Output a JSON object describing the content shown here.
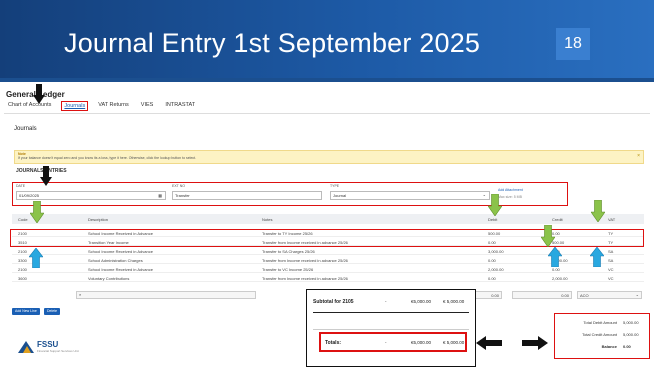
{
  "slide": {
    "title": "Journal Entry 1st September 2025",
    "number": "18",
    "colors": {
      "banner": "#1d5aa6",
      "highlight": "#d11111",
      "green_arrow": "#8bc34a",
      "blue_arrow": "#29a8e0"
    }
  },
  "app": {
    "title": "General Ledger",
    "nav": [
      "Chart of Accounts",
      "Journals",
      "VAT Returns",
      "VIES",
      "INTRASTAT"
    ],
    "section_title": "Journals",
    "warning": {
      "heading": "Note",
      "text": "If your balance doesn't equal zero and you know its a loss, type it here. Otherwise, click the lookup button to select.",
      "close": "×"
    },
    "journal_title": "JOURNALS ENTRIES",
    "form": {
      "date_label": "DATE",
      "date_value": "01/09/2025",
      "ref_label": "EXT NO",
      "ref_value": "Transfer",
      "type_label": "TYPE",
      "type_value": "Journal",
      "attach_link": "Add Attachment",
      "attach_sub": "Max size: 5 MB"
    },
    "table": {
      "headers": [
        "Code",
        "Description",
        "Notes",
        "Debit",
        "Credit",
        "VAT"
      ],
      "rows": [
        {
          "code": "2100",
          "desc": "School Income Received in Advance",
          "notes": "Transfer to TY Income 25/26",
          "debit": "500.00",
          "credit": "0.00",
          "vat": "TY"
        },
        {
          "code": "3510",
          "desc": "Transition Year Income",
          "notes": "Transfer from Income received in advance 25/26",
          "debit": "0.00",
          "credit": "500.00",
          "vat": "TY"
        },
        {
          "code": "2100",
          "desc": "School Income Received in Advance",
          "notes": "Transfer to SA Charges 25/26",
          "debit": "3,000.00",
          "credit": "0.00",
          "vat": "SA"
        },
        {
          "code": "3300",
          "desc": "School Administration Charges",
          "notes": "Transfer from Income received in advance 25/26",
          "debit": "0.00",
          "credit": "3,000.00",
          "vat": "SA"
        },
        {
          "code": "2100",
          "desc": "School Income Received in Advance",
          "notes": "Transfer to VC Income 25/26",
          "debit": "2,000.00",
          "credit": "0.00",
          "vat": "VC"
        },
        {
          "code": "3600",
          "desc": "Voluntary Contributions",
          "notes": "Transfer from Income received in advance 25/26",
          "debit": "0.00",
          "credit": "2,000.00",
          "vat": "VC"
        }
      ],
      "entry": {
        "debit": "0.00",
        "credit": "0.00",
        "vat": "ACO"
      }
    },
    "buttons": {
      "add_line": "Add New Line",
      "delete": "Delete"
    }
  },
  "totals_callout": {
    "subtotal_label": "Subtotal for 2105",
    "subtotal_dash": "-",
    "subtotal_debit": "€5,000.00",
    "subtotal_credit": "€ 5,000.00",
    "totals_label": "Totals:",
    "totals_dash": "-",
    "totals_debit": "€5,000.00",
    "totals_credit": "€ 5,000.00"
  },
  "summary": {
    "debit_label": "Total Debit Amount",
    "debit_value": "5,000.00",
    "credit_label": "Total Credit Amount",
    "credit_value": "5,000.00",
    "balance_label": "Balance",
    "balance_value": "0.00"
  },
  "logo": {
    "name": "FSSU",
    "sub": "Financial Support Services Unit"
  }
}
